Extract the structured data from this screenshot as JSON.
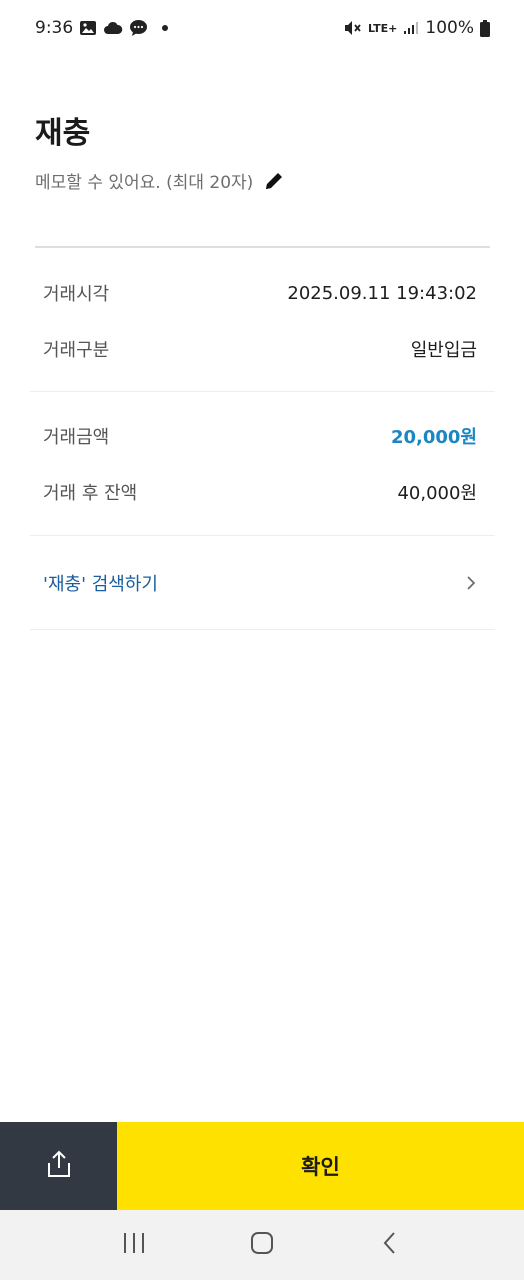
{
  "status_bar": {
    "time": "9:36",
    "network": "LTE+",
    "battery": "100%"
  },
  "header": {
    "title": "재충",
    "memo_placeholder": "메모할 수 있어요. (최대 20자)"
  },
  "details": {
    "time_label": "거래시각",
    "time_value": "2025.09.11 19:43:02",
    "type_label": "거래구분",
    "type_value": "일반입금",
    "amount_label": "거래금액",
    "amount_value": "20,000원",
    "balance_label": "거래 후 잔액",
    "balance_value": "40,000원"
  },
  "search": {
    "label": "'재충' 검색하기"
  },
  "bottom": {
    "confirm_label": "확인"
  },
  "colors": {
    "accent_blue": "#1a86c4",
    "link_blue": "#1b5fa0",
    "confirm_yellow": "#ffe100",
    "share_dark": "#333943"
  }
}
